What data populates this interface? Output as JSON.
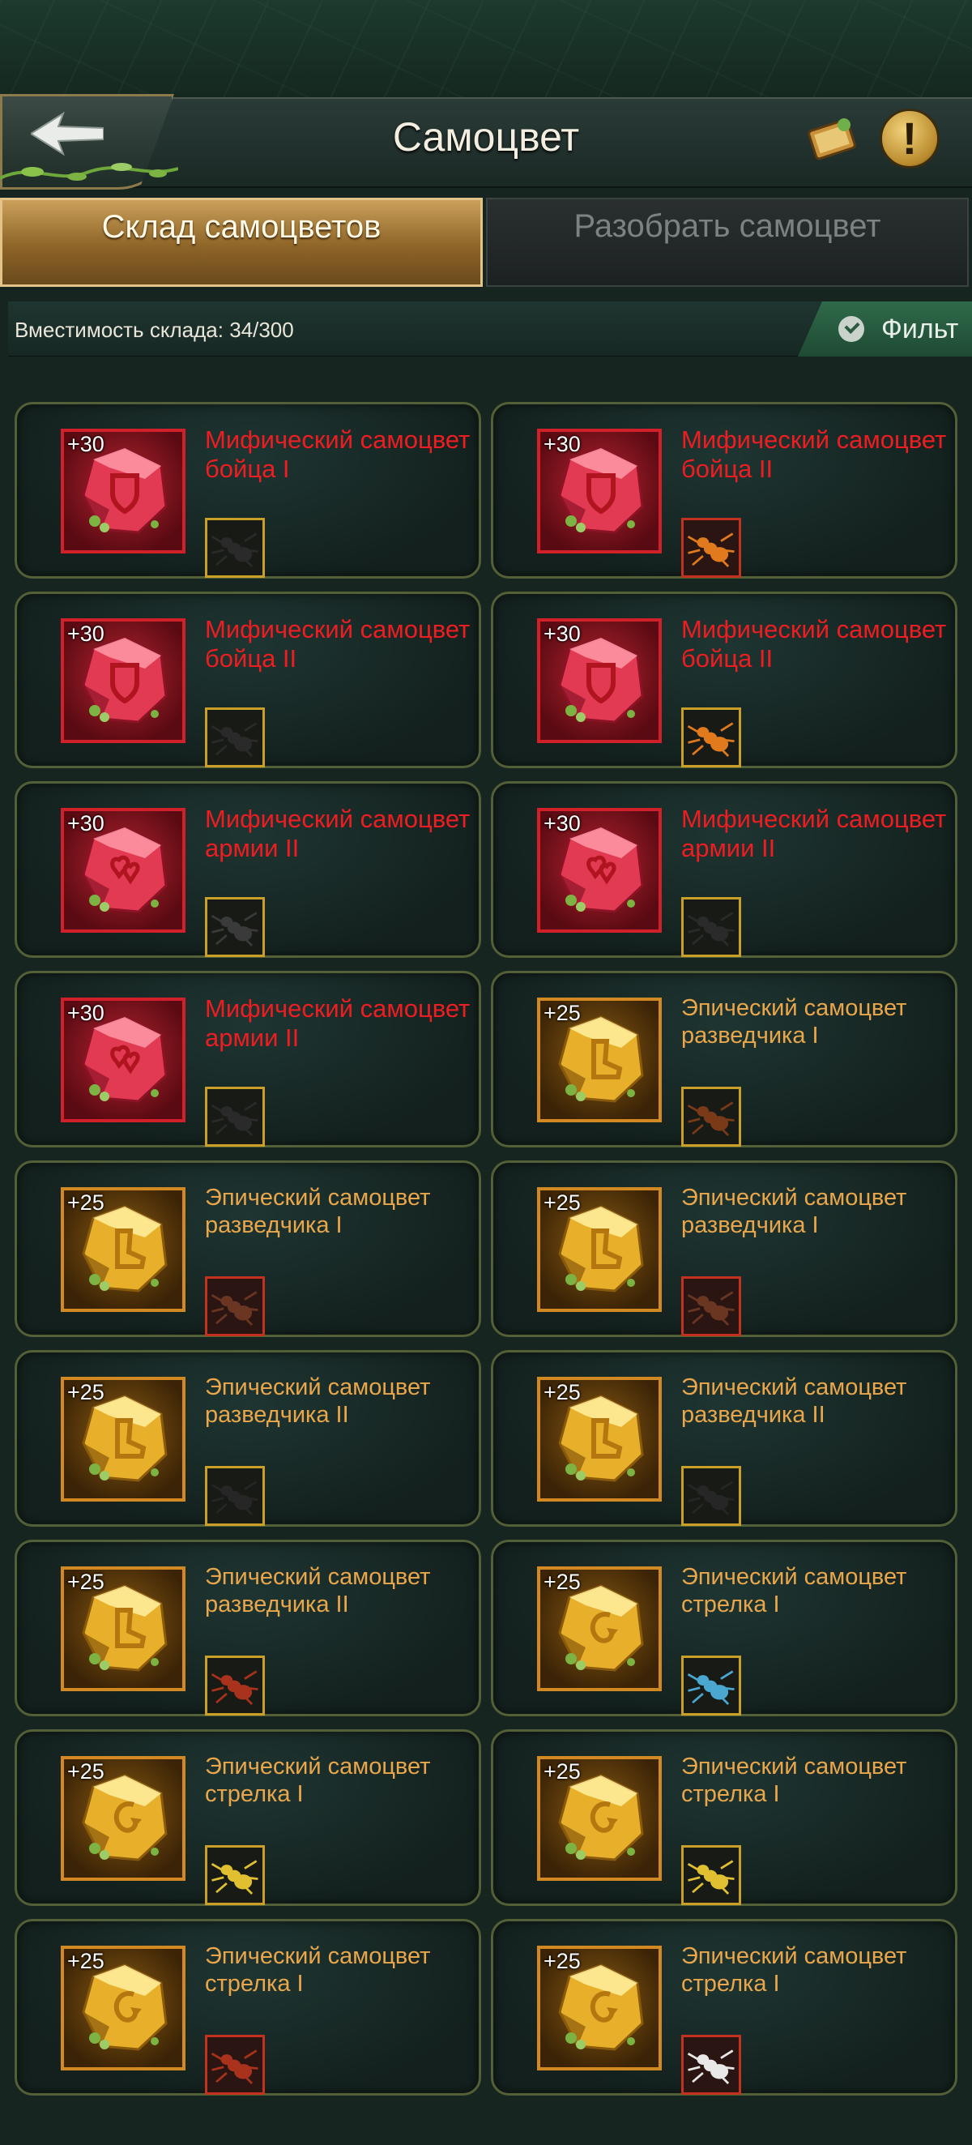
{
  "header": {
    "title": "Самоцвет",
    "icons": [
      "back-arrow-icon",
      "guide-book-icon",
      "info-icon"
    ],
    "info_glyph": "!"
  },
  "tabs": [
    {
      "label": "Склад самоцветов",
      "active": true
    },
    {
      "label": "Разобрать самоцвет",
      "active": false
    }
  ],
  "storage": {
    "capacity_label": "Вместимость склада: 34/300",
    "filter_label": "Фильт"
  },
  "colors": {
    "mythic": "#ee1d22",
    "epic": "#e9a64a",
    "accent_gold": "#caa05a",
    "filter_green": "#2f6a4a"
  },
  "gems": [
    {
      "name": "Мифический самоцвет бойца I",
      "bonus": "+30",
      "rarity": "mythic",
      "symbol": "shield",
      "insect": "beetle-black",
      "insect_frame": "gold"
    },
    {
      "name": "Мифический самоцвет бойца II",
      "bonus": "+30",
      "rarity": "mythic",
      "symbol": "shield",
      "insect": "ant-orange",
      "insect_frame": "red"
    },
    {
      "name": "Мифический самоцвет бойца II",
      "bonus": "+30",
      "rarity": "mythic",
      "symbol": "shield",
      "insect": "beetle-black",
      "insect_frame": "gold"
    },
    {
      "name": "Мифический самоцвет бойца II",
      "bonus": "+30",
      "rarity": "mythic",
      "symbol": "shield",
      "insect": "ant-orange",
      "insect_frame": "gold"
    },
    {
      "name": "Мифический самоцвет армии II",
      "bonus": "+30",
      "rarity": "mythic",
      "symbol": "hearts",
      "insect": "mantis-dark",
      "insect_frame": "gold"
    },
    {
      "name": "Мифический самоцвет армии II",
      "bonus": "+30",
      "rarity": "mythic",
      "symbol": "hearts",
      "insect": "beetle-black",
      "insect_frame": "gold"
    },
    {
      "name": "Мифический самоцвет армии II",
      "bonus": "+30",
      "rarity": "mythic",
      "symbol": "hearts",
      "insect": "beetle-black",
      "insect_frame": "gold"
    },
    {
      "name": "Эпический самоцвет разведчика I",
      "bonus": "+25",
      "rarity": "epic",
      "symbol": "boot",
      "insect": "ant-brown",
      "insect_frame": "gold"
    },
    {
      "name": "Эпический самоцвет разведчика I",
      "bonus": "+25",
      "rarity": "epic",
      "symbol": "boot",
      "insect": "spider-brown",
      "insect_frame": "red"
    },
    {
      "name": "Эпический самоцвет разведчика I",
      "bonus": "+25",
      "rarity": "epic",
      "symbol": "boot",
      "insect": "spider-brown",
      "insect_frame": "red"
    },
    {
      "name": "Эпический самоцвет разведчика II",
      "bonus": "+25",
      "rarity": "epic",
      "symbol": "boot",
      "insect": "ant-black",
      "insect_frame": "gold"
    },
    {
      "name": "Эпический самоцвет разведчика II",
      "bonus": "+25",
      "rarity": "epic",
      "symbol": "boot",
      "insect": "ant-black",
      "insect_frame": "gold"
    },
    {
      "name": "Эпический самоцвет разведчика II",
      "bonus": "+25",
      "rarity": "epic",
      "symbol": "boot",
      "insect": "ant-red",
      "insect_frame": "gold"
    },
    {
      "name": "Эпический самоцвет стрелка I",
      "bonus": "+25",
      "rarity": "epic",
      "symbol": "hook",
      "insect": "beetle-blue",
      "insect_frame": "gold"
    },
    {
      "name": "Эпический самоцвет стрелка I",
      "bonus": "+25",
      "rarity": "epic",
      "symbol": "hook",
      "insect": "beetle-yellow",
      "insect_frame": "gold"
    },
    {
      "name": "Эпический самоцвет стрелка I",
      "bonus": "+25",
      "rarity": "epic",
      "symbol": "hook",
      "insect": "beetle-yellow",
      "insect_frame": "gold"
    },
    {
      "name": "Эпический самоцвет стрелка I",
      "bonus": "+25",
      "rarity": "epic",
      "symbol": "hook",
      "insect": "ant-red",
      "insect_frame": "red"
    },
    {
      "name": "Эпический самоцвет стрелка I",
      "bonus": "+25",
      "rarity": "epic",
      "symbol": "hook",
      "insect": "mite-white",
      "insect_frame": "red"
    }
  ]
}
